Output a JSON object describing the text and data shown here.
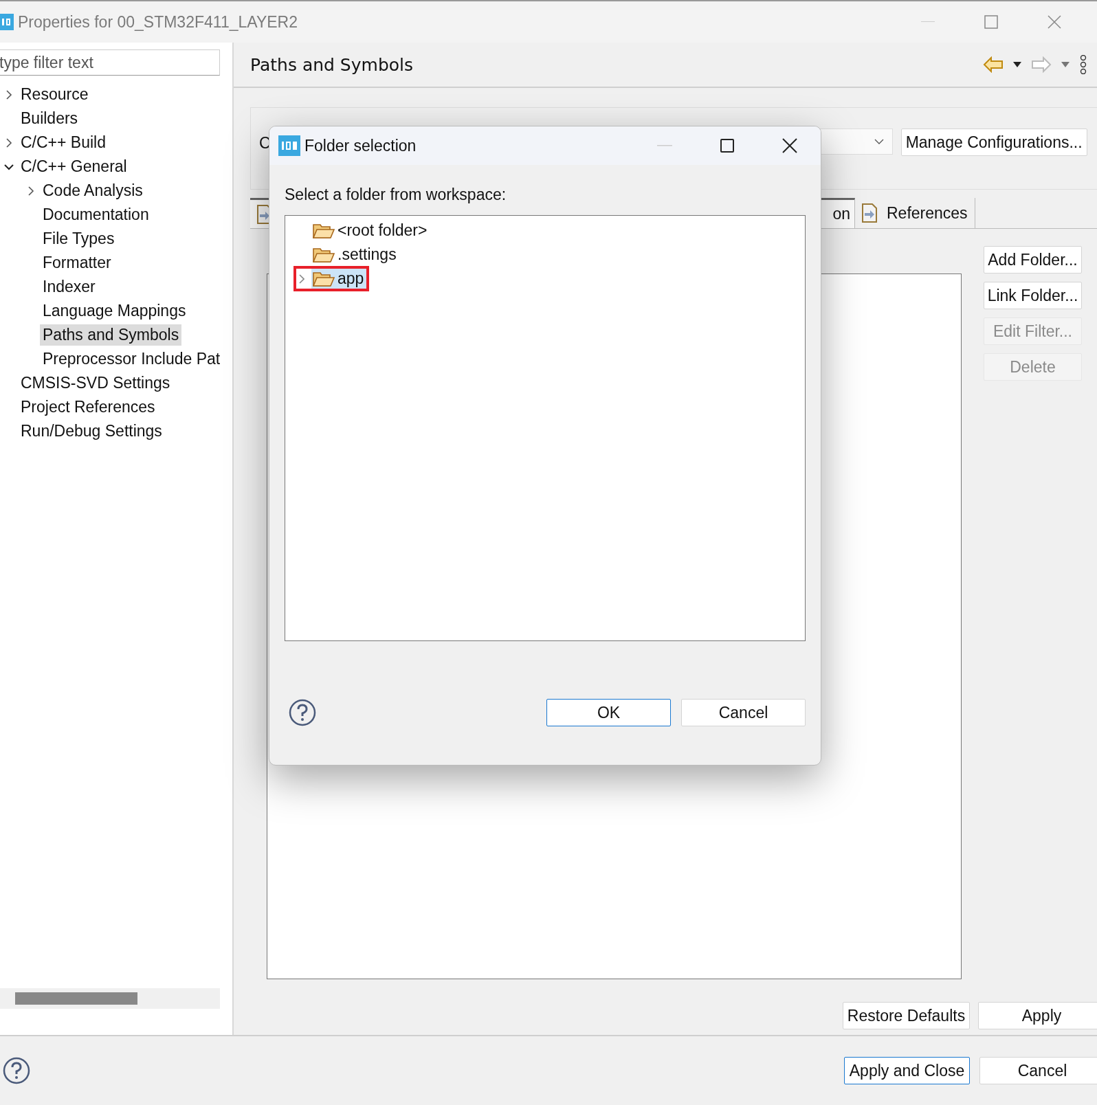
{
  "window": {
    "title": "Properties for 00_STM32F411_LAYER2"
  },
  "filter": {
    "placeholder": "type filter text"
  },
  "sidebar": {
    "items": [
      {
        "label": "Resource",
        "has_children": true,
        "expanded": false,
        "selected": false
      },
      {
        "label": "Builders",
        "has_children": false,
        "selected": false
      },
      {
        "label": "C/C++ Build",
        "has_children": true,
        "expanded": false,
        "selected": false
      },
      {
        "label": "C/C++ General",
        "has_children": true,
        "expanded": true,
        "selected": false,
        "children": [
          {
            "label": "Code Analysis",
            "has_children": true,
            "expanded": false,
            "selected": false
          },
          {
            "label": "Documentation",
            "has_children": false,
            "selected": false
          },
          {
            "label": "File Types",
            "has_children": false,
            "selected": false
          },
          {
            "label": "Formatter",
            "has_children": false,
            "selected": false
          },
          {
            "label": "Indexer",
            "has_children": false,
            "selected": false
          },
          {
            "label": "Language Mappings",
            "has_children": false,
            "selected": false
          },
          {
            "label": "Paths and Symbols",
            "has_children": false,
            "selected": true
          },
          {
            "label": "Preprocessor Include Pat",
            "has_children": false,
            "selected": false
          }
        ]
      },
      {
        "label": "CMSIS-SVD Settings",
        "has_children": false,
        "selected": false
      },
      {
        "label": "Project References",
        "has_children": false,
        "selected": false
      },
      {
        "label": "Run/Debug Settings",
        "has_children": false,
        "selected": false
      }
    ]
  },
  "page": {
    "title": "Paths and Symbols",
    "configuration_label": "C",
    "manage_button": "Manage Configurations...",
    "tabs": [
      {
        "label": "on",
        "selected": true
      },
      {
        "label": "References",
        "selected": false
      }
    ],
    "side_buttons": [
      {
        "label": "Add Folder...",
        "disabled": false
      },
      {
        "label": "Link Folder...",
        "disabled": false
      },
      {
        "label": "Edit Filter...",
        "disabled": true
      },
      {
        "label": "Delete",
        "disabled": true
      }
    ],
    "restore_button": "Restore Defaults",
    "apply_button": "Apply"
  },
  "footer": {
    "buttons": [
      {
        "label": "Apply and Close",
        "default": true
      },
      {
        "label": "Cancel",
        "default": false
      }
    ]
  },
  "dialog": {
    "title": "Folder selection",
    "prompt": "Select a folder from workspace:",
    "folders": [
      {
        "label": "<root folder>",
        "has_children": false,
        "selected": false,
        "marked": false
      },
      {
        "label": ".settings",
        "has_children": false,
        "selected": false,
        "marked": false
      },
      {
        "label": "app",
        "has_children": true,
        "selected": true,
        "marked": true
      }
    ],
    "buttons": [
      {
        "label": "OK",
        "default": true
      },
      {
        "label": "Cancel",
        "default": false
      }
    ]
  }
}
